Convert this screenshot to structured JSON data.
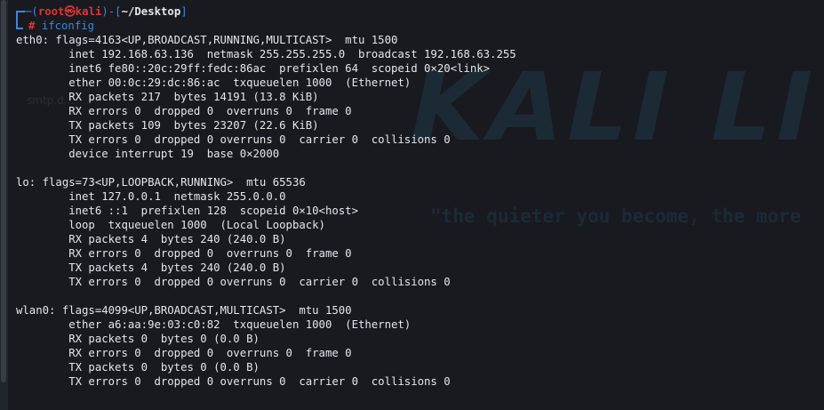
{
  "prompt": {
    "open_dash": "─(",
    "user": "root",
    "at_symbol": "㉿",
    "host": "kali",
    "close_paren": ")-[",
    "cwd": "~/Desktop",
    "close_bracket": "]",
    "hash": "#",
    "command": "ifconfig"
  },
  "output": [
    "eth0: flags=4163<UP,BROADCAST,RUNNING,MULTICAST>  mtu 1500",
    "        inet 192.168.63.136  netmask 255.255.255.0  broadcast 192.168.63.255",
    "        inet6 fe80::20c:29ff:fedc:86ac  prefixlen 64  scopeid 0×20<link>",
    "        ether 00:0c:29:dc:86:ac  txqueuelen 1000  (Ethernet)",
    "        RX packets 217  bytes 14191 (13.8 KiB)",
    "        RX errors 0  dropped 0  overruns 0  frame 0",
    "        TX packets 109  bytes 23207 (22.6 KiB)",
    "        TX errors 0  dropped 0 overruns 0  carrier 0  collisions 0",
    "        device interrupt 19  base 0×2000",
    "",
    "lo: flags=73<UP,LOOPBACK,RUNNING>  mtu 65536",
    "        inet 127.0.0.1  netmask 255.0.0.0",
    "        inet6 ::1  prefixlen 128  scopeid 0×10<host>",
    "        loop  txqueuelen 1000  (Local Loopback)",
    "        RX packets 4  bytes 240 (240.0 B)",
    "        RX errors 0  dropped 0  overruns 0  frame 0",
    "        TX packets 4  bytes 240 (240.0 B)",
    "        TX errors 0  dropped 0 overruns 0  carrier 0  collisions 0",
    "",
    "wlan0: flags=4099<UP,BROADCAST,MULTICAST>  mtu 1500",
    "        ether a6:aa:9e:03:c0:82  txqueuelen 1000  (Ethernet)",
    "        RX packets 0  bytes 0 (0.0 B)",
    "        RX errors 0  dropped 0  overruns 0  frame 0",
    "        TX packets 0  bytes 0 (0.0 B)",
    "        TX errors 0  dropped 0 overruns 0  carrier 0  collisions 0"
  ],
  "watermark": {
    "logo_text": "KALI LI",
    "slogan": "\"the quieter you become, the more",
    "ghost_text": "smtp.d..."
  },
  "colors": {
    "background": "#181a20",
    "prompt_blue": "#3b87dd",
    "prompt_red": "#e03535",
    "text": "#e6e6e6",
    "watermark": "#1c2a36"
  }
}
